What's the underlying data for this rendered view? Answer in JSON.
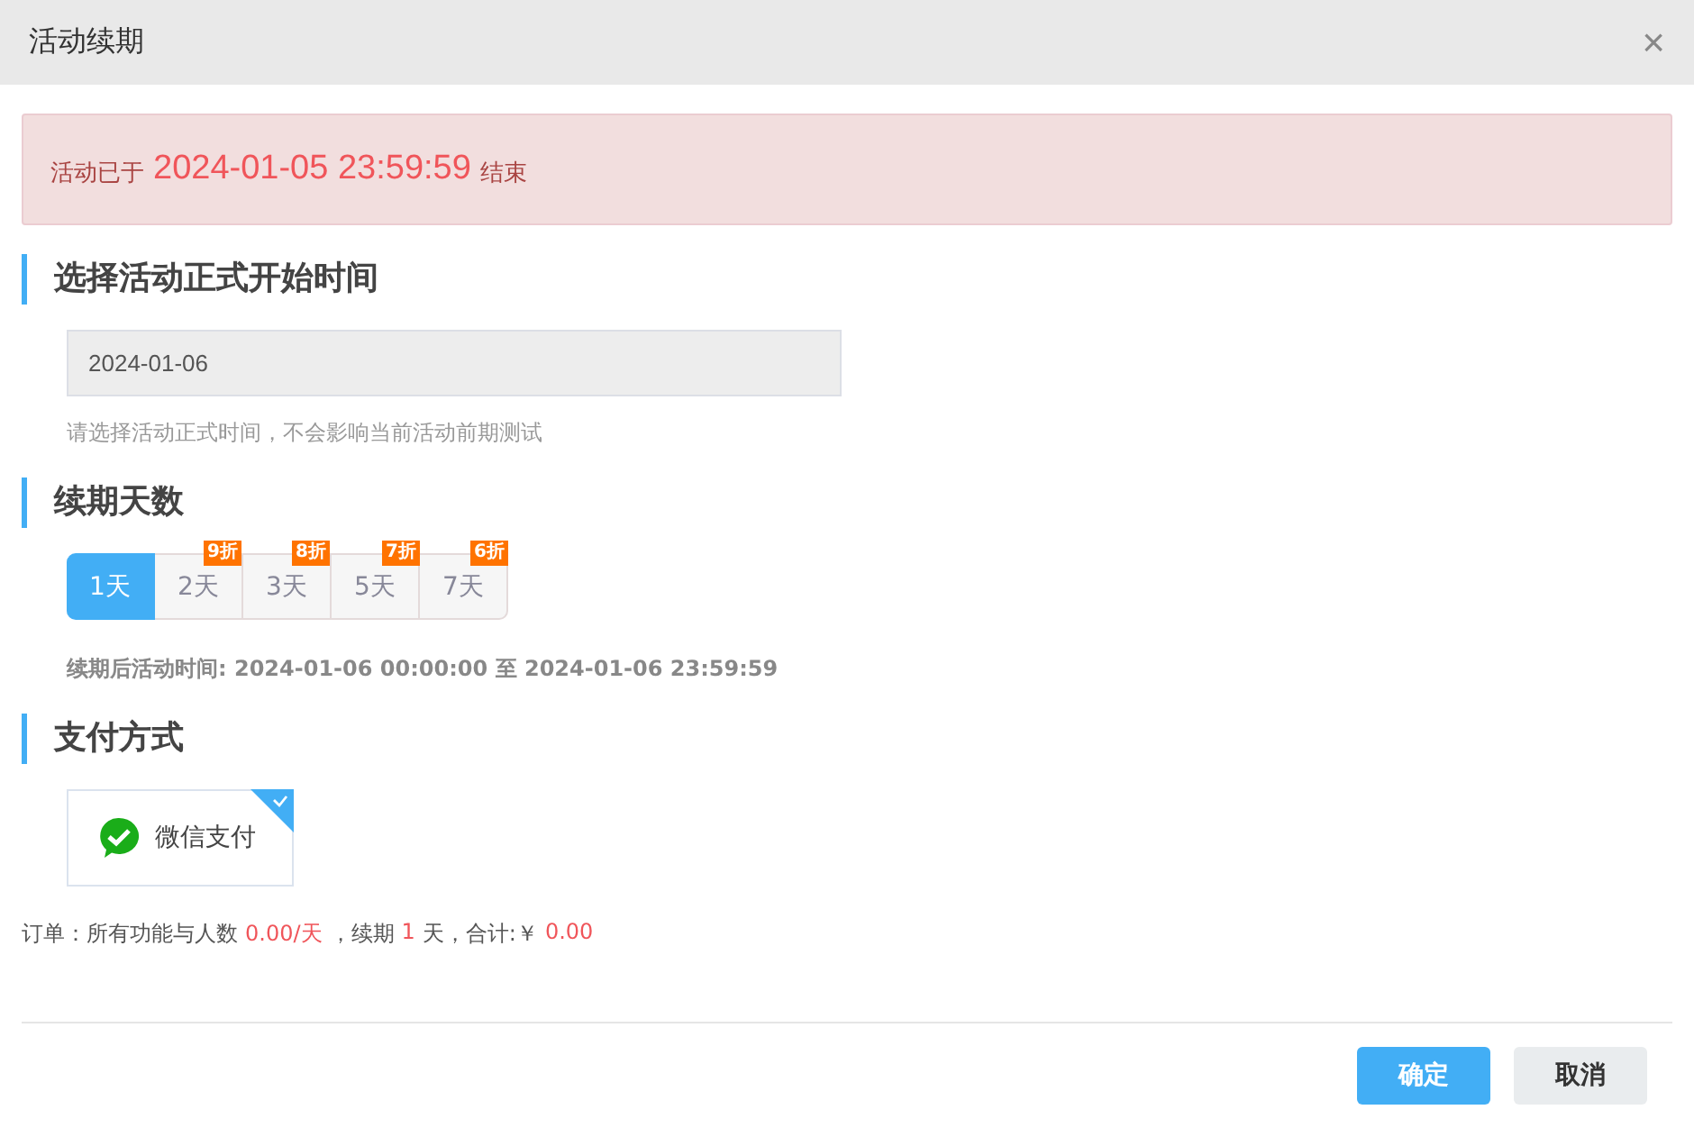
{
  "window": {
    "title": "活动续期",
    "close": "×"
  },
  "alert": {
    "prefix": "活动已于",
    "date": "2024-01-05 23:59:59",
    "suffix": "结束"
  },
  "start_section": {
    "heading": "选择活动正式开始时间",
    "date_field": {
      "value": "2024-01-06"
    },
    "hint": "请选择活动正式时间，不会影响当前活动前期测试"
  },
  "days_section": {
    "heading": "续期天数",
    "options": [
      {
        "label": "1天",
        "selected": true
      },
      {
        "label": "2天",
        "selected": false,
        "badge": "9折"
      },
      {
        "label": "3天",
        "selected": false,
        "badge": "8折"
      },
      {
        "label": "5天",
        "selected": false,
        "badge": "7折"
      },
      {
        "label": "7天",
        "selected": false,
        "badge": "6折"
      }
    ],
    "period": "续期后活动时间: 2024-01-06 00:00:00 至 2024-01-06 23:59:59"
  },
  "payment_section": {
    "heading": "支付方式",
    "methods": [
      {
        "label": "微信支付",
        "selected": true
      }
    ]
  },
  "order": [
    {
      "kind": "plain",
      "text": "订单：所有功能与人数"
    },
    {
      "kind": "highlight",
      "text": "0.00/天"
    },
    {
      "kind": "plain",
      "text": "，续期"
    },
    {
      "kind": "highlight",
      "text": "1"
    },
    {
      "kind": "plain",
      "text": "天，合计:￥"
    },
    {
      "kind": "highlight",
      "text": "0.00"
    }
  ],
  "buttons": [
    {
      "label": "确定",
      "kind": "primary"
    },
    {
      "label": "取消",
      "kind": "secondary"
    }
  ]
}
